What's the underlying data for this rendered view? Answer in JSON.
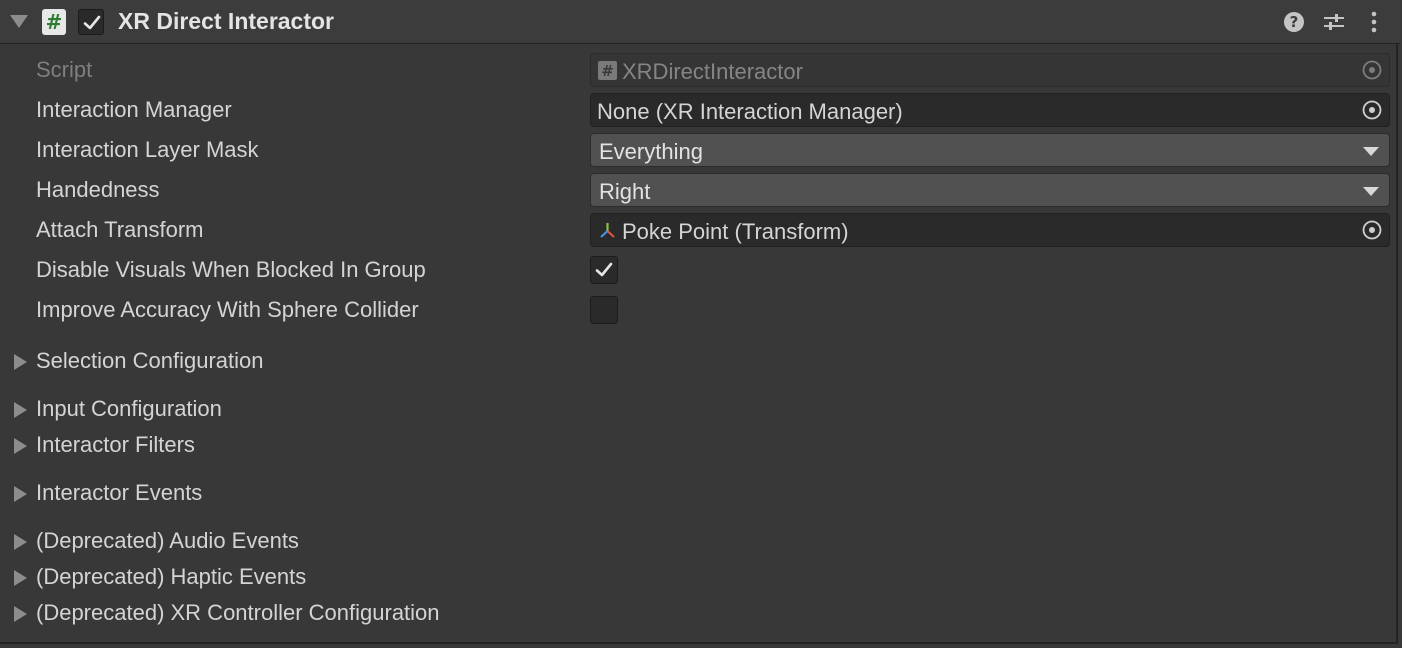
{
  "component": {
    "title": "XR Direct Interactor",
    "enabled": true
  },
  "fields": {
    "script": {
      "label": "Script",
      "value": "XRDirectInteractor"
    },
    "interaction_manager": {
      "label": "Interaction Manager",
      "value": "None (XR Interaction Manager)"
    },
    "interaction_layer_mask": {
      "label": "Interaction Layer Mask",
      "value": "Everything"
    },
    "handedness": {
      "label": "Handedness",
      "value": "Right"
    },
    "attach_transform": {
      "label": "Attach Transform",
      "value": "Poke Point (Transform)"
    },
    "disable_visuals": {
      "label": "Disable Visuals When Blocked In Group",
      "checked": true
    },
    "improve_accuracy": {
      "label": "Improve Accuracy With Sphere Collider",
      "checked": false
    }
  },
  "foldouts": [
    {
      "label": "Selection Configuration"
    },
    {
      "label": "Input Configuration"
    },
    {
      "label": "Interactor Filters"
    },
    {
      "label": "Interactor Events"
    },
    {
      "label": "(Deprecated) Audio Events"
    },
    {
      "label": "(Deprecated) Haptic Events"
    },
    {
      "label": "(Deprecated) XR Controller Configuration"
    }
  ],
  "colors": {
    "background": "#383838",
    "field": "#2a2a2a",
    "dropdown": "#515151",
    "text": "#d4d4d4"
  },
  "icons": [
    "foldout-arrow-icon",
    "script-icon",
    "checkmark-icon",
    "help-icon",
    "presets-icon",
    "more-icon",
    "object-picker-icon",
    "transform-icon"
  ]
}
